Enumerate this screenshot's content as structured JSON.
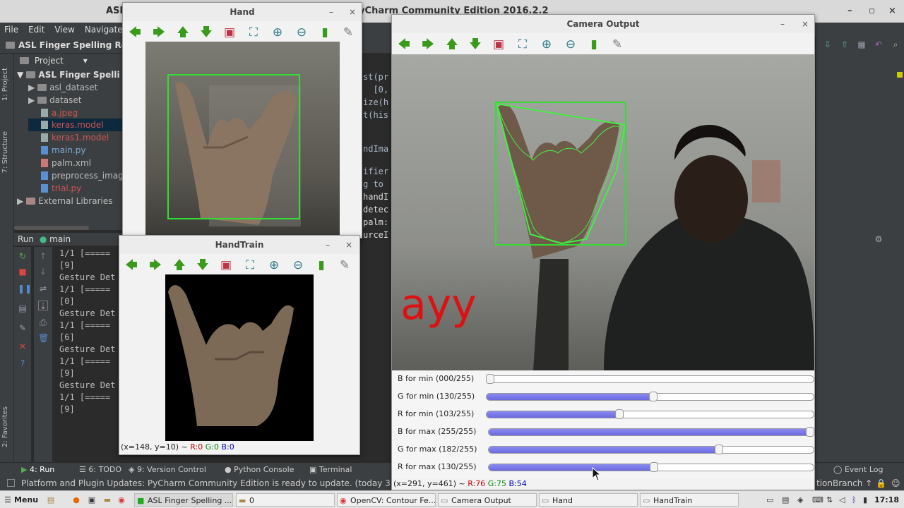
{
  "ide": {
    "title": "ASL Finger Spelling Recognition] - .../main.py - PyCharm Community Edition 2016.2.2",
    "title_prefix": "ASL",
    "project_name": "ASL Finger Spelling Re",
    "project_tab": "Project",
    "menu": [
      "File",
      "Edit",
      "View",
      "Navigate"
    ],
    "tree": [
      {
        "label": "ASL Finger Spelli",
        "kind": "folder",
        "open": true
      },
      {
        "label": "asl_dataset",
        "kind": "folder"
      },
      {
        "label": "dataset",
        "kind": "folder"
      },
      {
        "label": "a.jpeg",
        "kind": "file",
        "color": "#cc5555"
      },
      {
        "label": "keras.model",
        "kind": "file",
        "color": "#cc5555",
        "selected": true
      },
      {
        "label": "keras1.model",
        "kind": "file",
        "color": "#cc5555"
      },
      {
        "label": "main.py",
        "kind": "file",
        "color": "#7ea9d8"
      },
      {
        "label": "palm.xml",
        "kind": "file",
        "color": "#bbbbbb"
      },
      {
        "label": "preprocess_imag",
        "kind": "file",
        "color": "#bbbbbb"
      },
      {
        "label": "trial.py",
        "kind": "file",
        "color": "#cc5555"
      },
      {
        "label": "External Libraries",
        "kind": "lib"
      }
    ],
    "side_tabs": [
      "1: Project",
      "7: Structure",
      "2: Favorites"
    ],
    "run_header": "Run",
    "run_config": "main",
    "console": [
      "1/1 [=====",
      "[9]",
      "Gesture Det",
      "1/1 [=====",
      "[0]",
      "Gesture Det",
      "1/1 [=====",
      "[6]",
      "Gesture Det",
      "1/1 [=====",
      "[9]",
      "Gesture Det",
      "1/1 [=====",
      "[9]"
    ],
    "code": [
      "st(pr",
      "  [0,",
      "ize(h",
      "t(his",
      "",
      "ndIma",
      "",
      "ifier",
      "g to",
      "handI",
      "detec",
      "palm:",
      "urceI"
    ],
    "tool_tabs": [
      "4: Run",
      "6: TODO",
      "9: Version Control",
      "Python Console",
      "Terminal",
      "Event Log"
    ],
    "status": "Platform and Plugin Updates: PyCharm Community Edition is ready to update. (today 3:59 PM)",
    "branch": "tionBranch ↑"
  },
  "windows": {
    "hand": {
      "title": "Hand"
    },
    "handtrain": {
      "title": "HandTrain",
      "status_prefix": "(x=148, y=10) ~",
      "r": "R:0",
      "g": "G:0",
      "b": "B:0"
    },
    "camera": {
      "title": "Camera Output",
      "overlay_text": "ayy",
      "status_prefix": "(x=291, y=461) ~",
      "r": "R:76",
      "g": "G:75",
      "b": "B:54"
    }
  },
  "trackbars": [
    {
      "label": "B for min  (000/255)",
      "value": 0
    },
    {
      "label": "G for min  (130/255)",
      "value": 130
    },
    {
      "label": "R for min  (103/255)",
      "value": 103
    },
    {
      "label": "B for max  (255/255)",
      "value": 255
    },
    {
      "label": "G for max  (182/255)",
      "value": 182
    },
    {
      "label": "R for max  (130/255)",
      "value": 130
    }
  ],
  "toolbar_icons": [
    "arrow-left-icon",
    "arrow-right-icon",
    "arrow-up-icon",
    "arrow-down-icon",
    "image-icon",
    "zoom-fit-icon",
    "zoom-in-icon",
    "zoom-out-icon",
    "save-icon",
    "properties-icon"
  ],
  "taskbar": {
    "menu": "Menu",
    "items": [
      "ASL Finger Spelling ...",
      "0",
      "OpenCV: Contour Fe...",
      "Camera Output",
      "Hand",
      "HandTrain"
    ],
    "clock": "17:18"
  }
}
